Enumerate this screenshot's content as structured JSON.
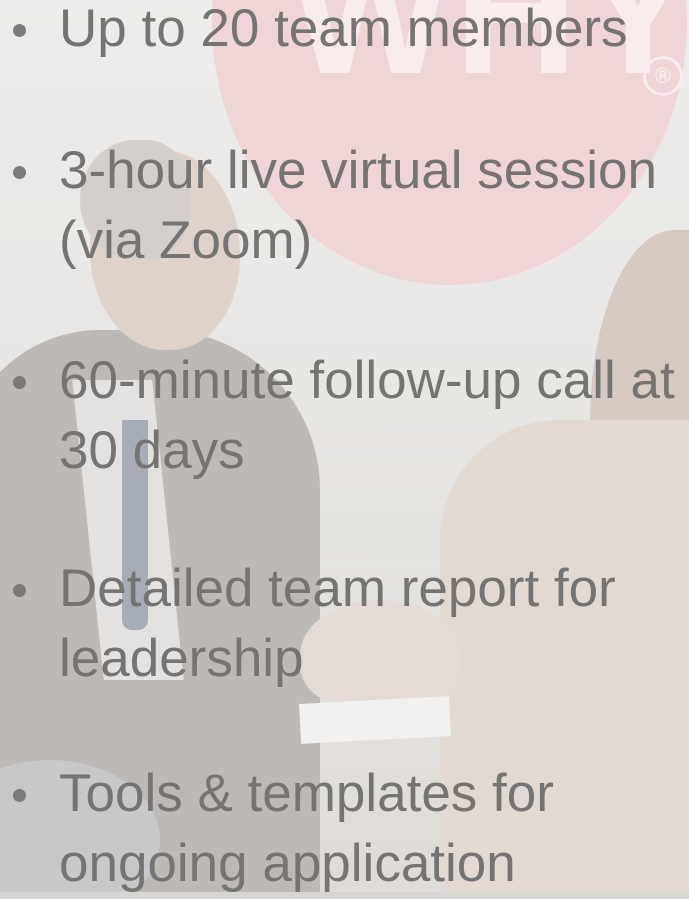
{
  "background": {
    "brand_mark": "WHY",
    "brand_registered": "®",
    "brand_color": "#ecc9cb",
    "description_icon": "meeting-photo"
  },
  "features": {
    "items": [
      {
        "line1": "Up to 20 team members",
        "line2": ""
      },
      {
        "line1": "3-hour live virtual session",
        "line2": "(via Zoom)"
      },
      {
        "line1": "60-minute follow-up call at",
        "line2": "30 days"
      },
      {
        "line1": "Detailed team report for",
        "line2": "leadership"
      },
      {
        "line1": "Tools & templates for",
        "line2": "ongoing application"
      }
    ]
  },
  "colors": {
    "text": "#767472",
    "bullet": "#7d7b79"
  }
}
